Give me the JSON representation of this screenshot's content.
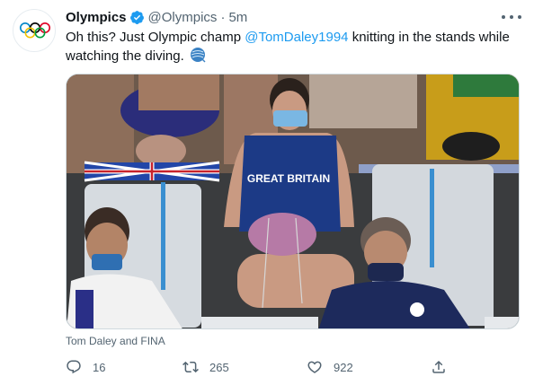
{
  "tweet": {
    "account_name": "Olympics",
    "handle": "@Olympics",
    "separator": "·",
    "time": "5m",
    "text_before": "Oh this? Just Olympic champ ",
    "mention": "@TomDaley1994",
    "text_after": " knitting in the stands while watching the diving.",
    "emoji": "yarn-emoji",
    "photo_text": "GREAT BRITAIN",
    "media_caption": "Tom Daley and FINA"
  },
  "actions": {
    "reply_count": "16",
    "retweet_count": "265",
    "like_count": "922"
  },
  "colors": {
    "accent": "#1d9bf0",
    "text": "#0f1419",
    "secondary": "#536471",
    "olympic_rings": [
      "#0085c7",
      "#f4c300",
      "#000000",
      "#009f3d",
      "#df0024"
    ]
  },
  "icons": [
    "olympic-rings-logo",
    "verified-badge-icon",
    "more-icon",
    "reply-icon",
    "retweet-icon",
    "like-icon",
    "share-icon"
  ]
}
